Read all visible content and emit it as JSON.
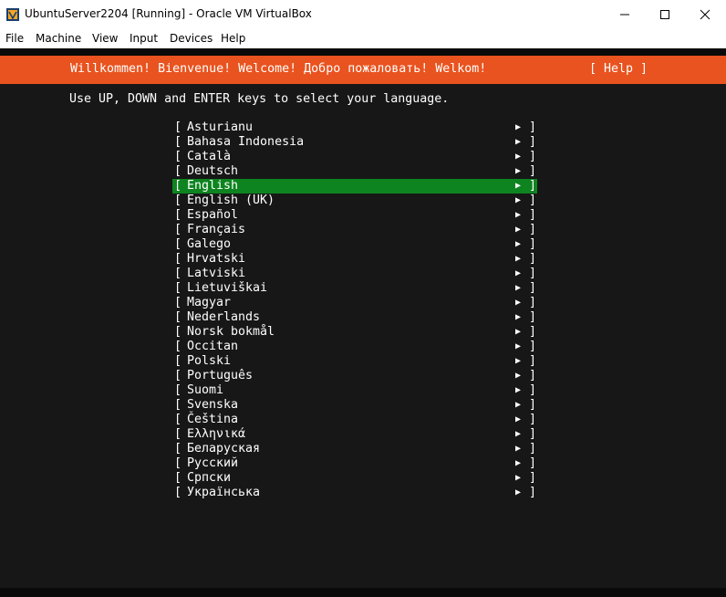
{
  "window": {
    "title": "UbuntuServer2204 [Running] - Oracle VM VirtualBox",
    "app_icon": "virtualbox-icon"
  },
  "menubar": {
    "items": [
      "File",
      "Machine",
      "View",
      "Input",
      "Devices",
      "Help"
    ]
  },
  "installer": {
    "banner_title": "Willkommen! Bienvenue! Welcome! Добро пожаловать! Welkom!",
    "help_button": "[ Help ]",
    "instruction": "Use UP, DOWN and ENTER keys to select your language.",
    "selected_index": 4,
    "languages": [
      "Asturianu",
      "Bahasa Indonesia",
      "Català",
      "Deutsch",
      "English",
      "English (UK)",
      "Español",
      "Français",
      "Galego",
      "Hrvatski",
      "Latviski",
      "Lietuviškai",
      "Magyar",
      "Nederlands",
      "Norsk bokmål",
      "Occitan",
      "Polski",
      "Português",
      "Suomi",
      "Svenska",
      "Čeština",
      "Ελληνικά",
      "Беларуская",
      "Русский",
      "Српски",
      "Українська"
    ]
  },
  "colors": {
    "banner": "#e9531f",
    "selection": "#0e8420",
    "screen_background": "#171717"
  }
}
